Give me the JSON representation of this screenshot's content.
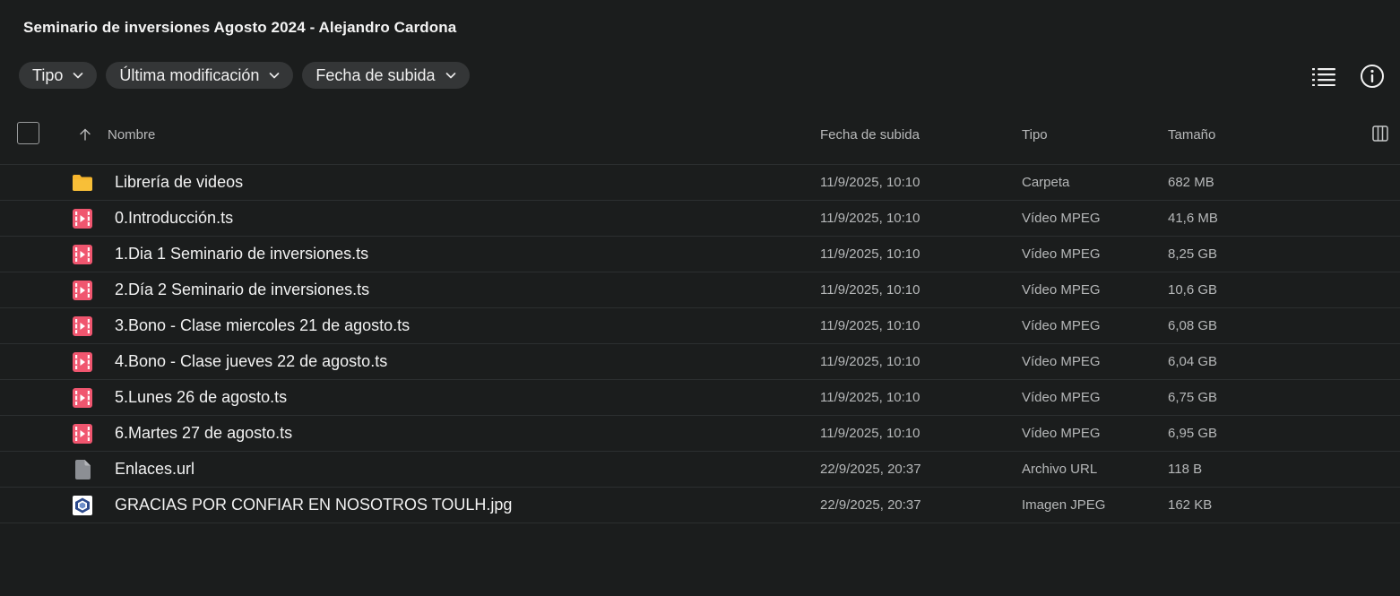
{
  "folder_title": "Seminario de inversiones Agosto 2024 - Alejandro Cardona",
  "filters": [
    {
      "label": "Tipo"
    },
    {
      "label": "Última modificación"
    },
    {
      "label": "Fecha de subida"
    }
  ],
  "columns": {
    "name": "Nombre",
    "uploaded": "Fecha de subida",
    "type": "Tipo",
    "size": "Tamaño"
  },
  "sort": {
    "column": "Nombre",
    "direction": "ascending"
  },
  "icons": {
    "list_view": "list-view-icon",
    "info": "info-icon",
    "columns": "columns-icon",
    "sort": "arrow-up-icon",
    "folder": "folder-icon",
    "video": "video-file-icon",
    "generic": "generic-file-icon",
    "image": "image-file-icon"
  },
  "colors": {
    "folder": "#f6b52d",
    "video": "#f0566f",
    "generic": "#8c8f94",
    "background": "#1b1d1d"
  },
  "rows": [
    {
      "icon": "folder",
      "name": "Librería de videos",
      "uploaded": "11/9/2025, 10:10",
      "type": "Carpeta",
      "size": "682 MB"
    },
    {
      "icon": "video",
      "name": "0.Introducción.ts",
      "uploaded": "11/9/2025, 10:10",
      "type": "Vídeo MPEG",
      "size": "41,6 MB"
    },
    {
      "icon": "video",
      "name": "1.Dia 1 Seminario de inversiones.ts",
      "uploaded": "11/9/2025, 10:10",
      "type": "Vídeo MPEG",
      "size": "8,25 GB"
    },
    {
      "icon": "video",
      "name": "2.Día 2 Seminario de inversiones.ts",
      "uploaded": "11/9/2025, 10:10",
      "type": "Vídeo MPEG",
      "size": "10,6 GB"
    },
    {
      "icon": "video",
      "name": "3.Bono - Clase miercoles 21 de agosto.ts",
      "uploaded": "11/9/2025, 10:10",
      "type": "Vídeo MPEG",
      "size": "6,08 GB"
    },
    {
      "icon": "video",
      "name": "4.Bono - Clase jueves 22 de agosto.ts",
      "uploaded": "11/9/2025, 10:10",
      "type": "Vídeo MPEG",
      "size": "6,04 GB"
    },
    {
      "icon": "video",
      "name": "5.Lunes 26 de agosto.ts",
      "uploaded": "11/9/2025, 10:10",
      "type": "Vídeo MPEG",
      "size": "6,75 GB"
    },
    {
      "icon": "video",
      "name": "6.Martes 27 de agosto.ts",
      "uploaded": "11/9/2025, 10:10",
      "type": "Vídeo MPEG",
      "size": "6,95 GB"
    },
    {
      "icon": "generic",
      "name": "Enlaces.url",
      "uploaded": "22/9/2025, 20:37",
      "type": "Archivo URL",
      "size": "118 B"
    },
    {
      "icon": "image",
      "name": "GRACIAS POR CONFIAR EN NOSOTROS TOULH.jpg",
      "uploaded": "22/9/2025, 20:37",
      "type": "Imagen JPEG",
      "size": "162 KB"
    }
  ]
}
